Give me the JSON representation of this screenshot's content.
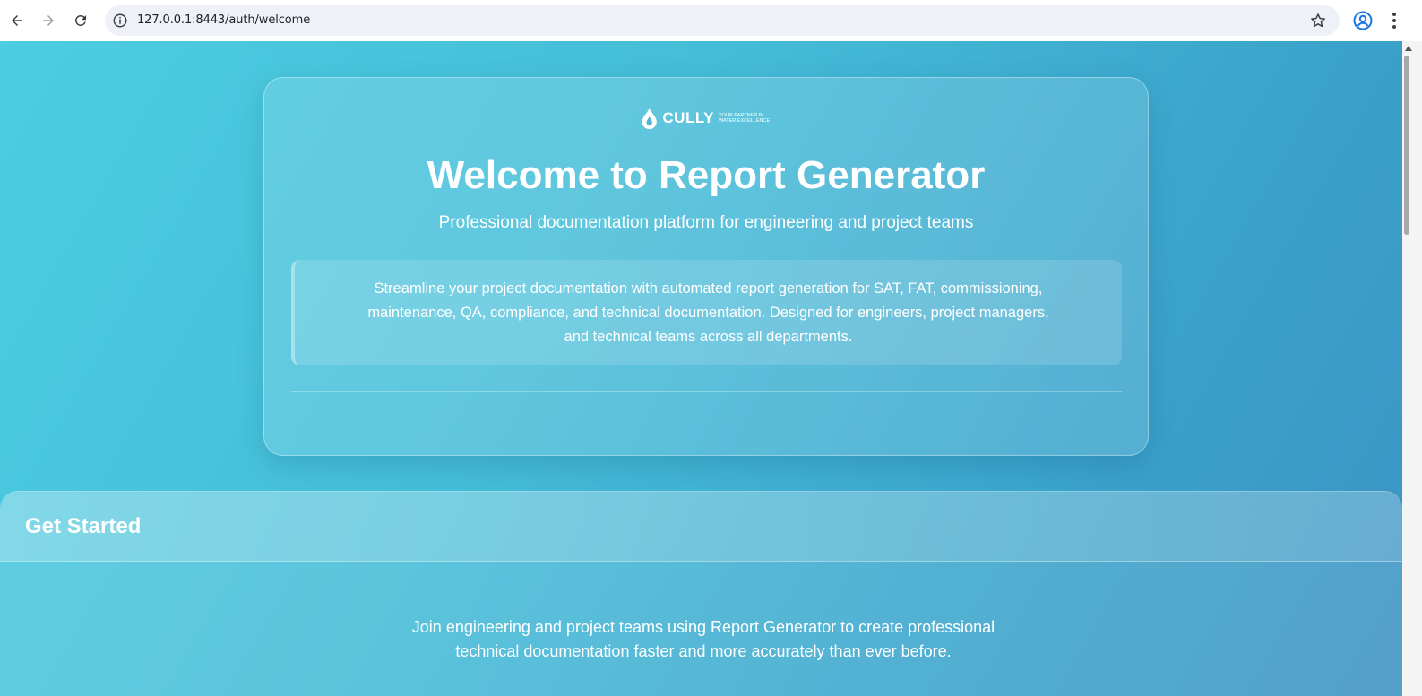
{
  "browser": {
    "url": "127.0.0.1:8443/auth/welcome"
  },
  "logo": {
    "name": "CULLY",
    "tagline": "YOUR PARTNER IN WATER EXCELLENCE"
  },
  "hero": {
    "title": "Welcome to Report Generator",
    "subtitle": "Professional documentation platform for engineering and project teams",
    "description": "Streamline your project documentation with automated report generation for SAT, FAT, commissioning, maintenance, QA, compliance, and technical documentation. Designed for engineers, project managers, and technical teams across all departments."
  },
  "get_started": {
    "title": "Get Started",
    "text": "Join engineering and project teams using Report Generator to create professional technical documentation faster and more accurately than ever before."
  }
}
